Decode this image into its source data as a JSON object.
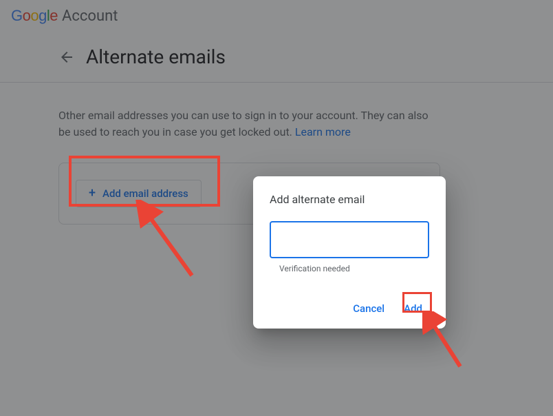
{
  "header": {
    "account_label": "Account"
  },
  "page": {
    "title": "Alternate emails",
    "description_prefix": "Other email addresses you can use to sign in to your account. They can also be used to reach you in case you get locked out. ",
    "learn_more": "Learn more"
  },
  "card": {
    "add_button_label": "Add email address"
  },
  "dialog": {
    "title": "Add alternate email",
    "input_value": "",
    "helper_text": "Verification needed",
    "cancel_label": "Cancel",
    "add_label": "Add"
  }
}
